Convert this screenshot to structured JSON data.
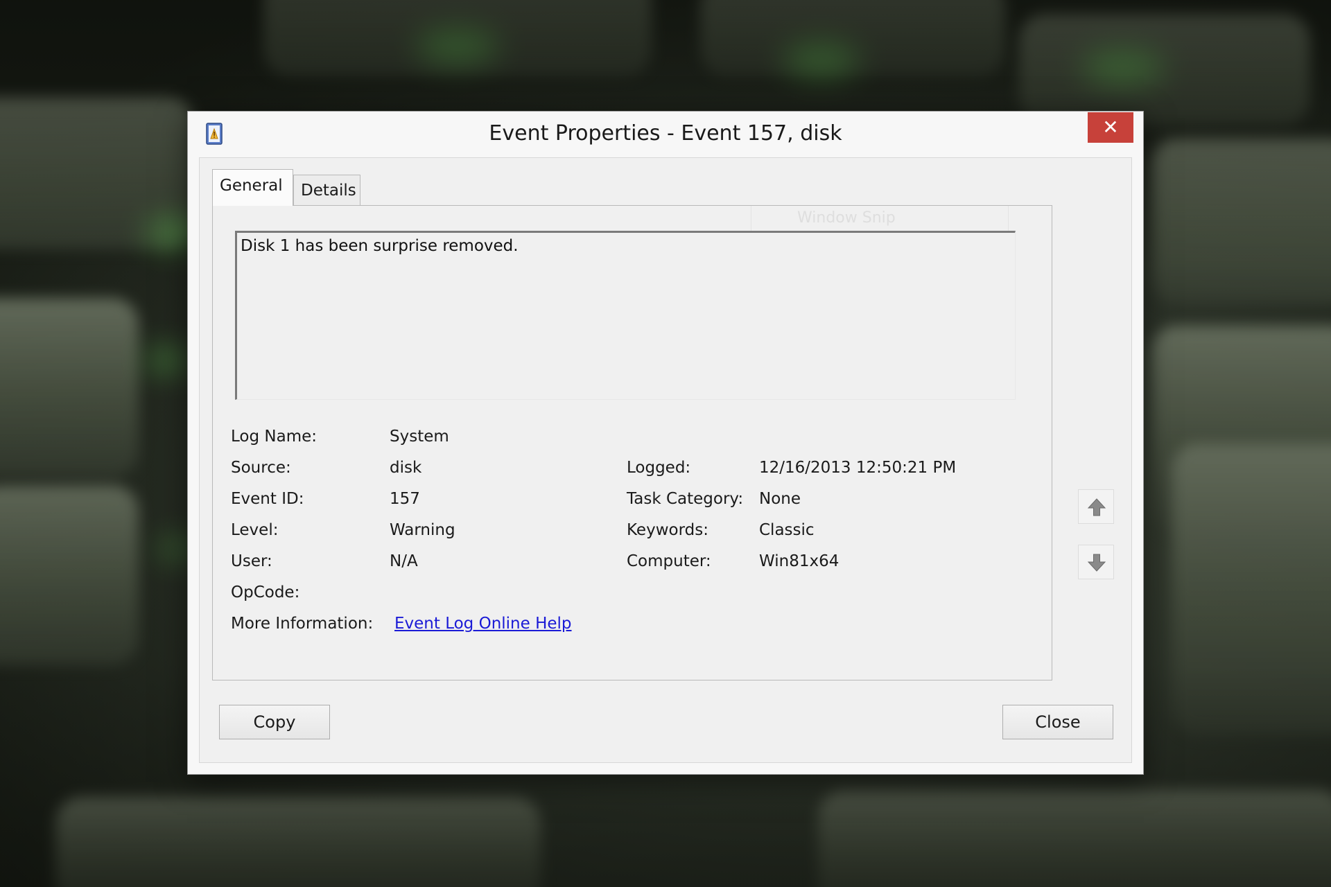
{
  "window": {
    "title": "Event Properties - Event 157, disk",
    "close_glyph": "✕",
    "icon": "event-viewer-icon"
  },
  "tabs": [
    {
      "label": "General",
      "selected": true
    },
    {
      "label": "Details",
      "selected": false
    }
  ],
  "ghost_overlay": "Window Snip",
  "description": "Disk 1 has been surprise removed.",
  "fields": {
    "log_name": {
      "label": "Log Name:",
      "value": "System"
    },
    "source": {
      "label": "Source:",
      "value": "disk"
    },
    "logged": {
      "label": "Logged:",
      "value": "12/16/2013 12:50:21 PM"
    },
    "event_id": {
      "label": "Event ID:",
      "value": "157"
    },
    "task_category": {
      "label": "Task Category:",
      "value": "None"
    },
    "level": {
      "label": "Level:",
      "value": "Warning"
    },
    "keywords": {
      "label": "Keywords:",
      "value": "Classic"
    },
    "user": {
      "label": "User:",
      "value": "N/A"
    },
    "computer": {
      "label": "Computer:",
      "value": "Win81x64"
    },
    "opcode": {
      "label": "OpCode:",
      "value": ""
    },
    "more_info": {
      "label": "More Information:",
      "link": "Event Log Online Help"
    }
  },
  "nav": {
    "up_icon": "arrow-up-icon",
    "down_icon": "arrow-down-icon"
  },
  "buttons": {
    "copy": "Copy",
    "close": "Close"
  },
  "colors": {
    "close_button": "#c7413a",
    "link": "#1a1ad6",
    "background_glow": "#6bd55c"
  }
}
